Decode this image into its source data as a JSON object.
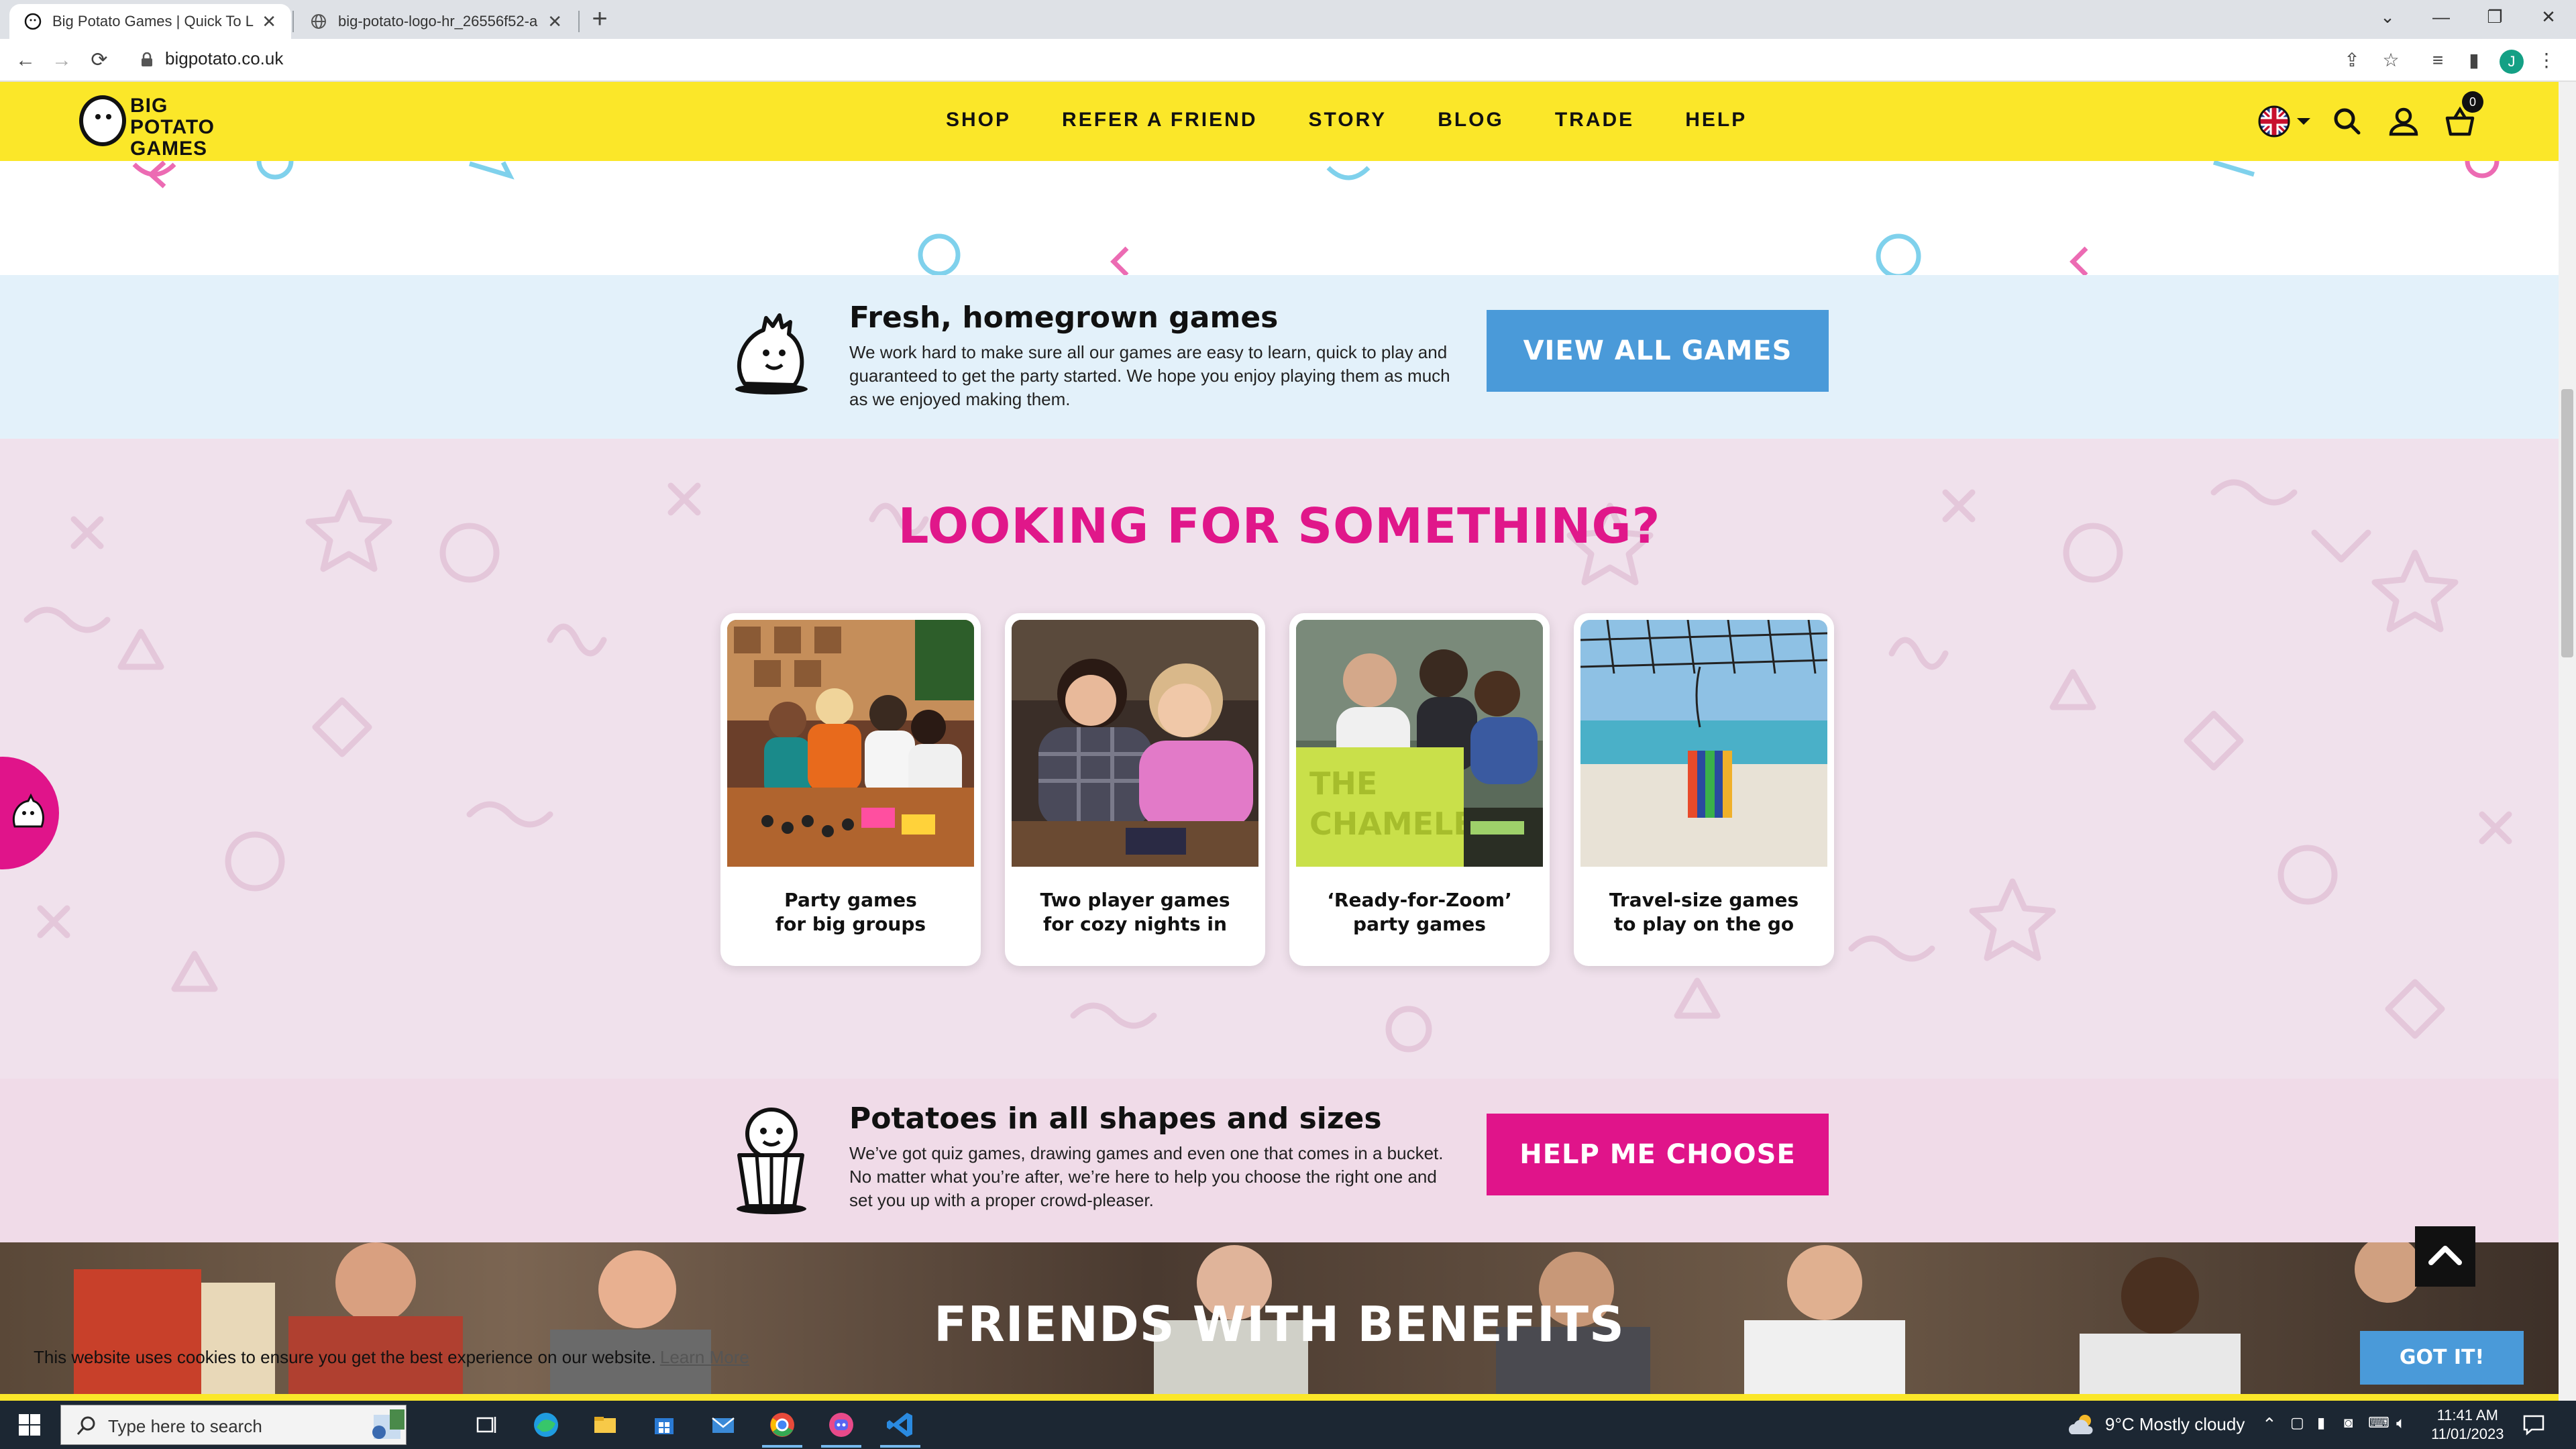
{
  "browser": {
    "tabs": [
      {
        "title": "Big Potato Games | Quick To Lea",
        "active": true
      },
      {
        "title": "big-potato-logo-hr_26556f52-a",
        "active": false
      }
    ],
    "url": "bigpotato.co.uk",
    "profile_initial": "J"
  },
  "header": {
    "logo_line1": "BIG POTATO",
    "logo_line2": "GAMES",
    "menu": [
      "SHOP",
      "REFER A FRIEND",
      "STORY",
      "BLOG",
      "TRADE",
      "HELP"
    ],
    "cart_count": "0"
  },
  "fresh": {
    "title": "Fresh, homegrown games",
    "body": "We work hard to make sure all our games are easy to learn, quick to play and guaranteed to get the party started. We hope you enjoy playing them as much as we enjoyed making them.",
    "button": "VIEW ALL GAMES"
  },
  "looking": {
    "title": "LOOKING FOR SOMETHING?",
    "cards": [
      {
        "line1": "Party games",
        "line2": "for big groups"
      },
      {
        "line1": "Two player games",
        "line2": "for cozy nights in"
      },
      {
        "line1": "‘Ready-for-Zoom’",
        "line2": "party games"
      },
      {
        "line1": "Travel-size games",
        "line2": "to play on the go"
      }
    ]
  },
  "potatoes": {
    "title": "Potatoes in all shapes and sizes",
    "body": "We’ve got quiz games, drawing games and even one that comes in a bucket. No matter what you’re after, we’re here to help you choose the right one and set you up with a proper crowd-pleaser.",
    "button": "HELP ME CHOOSE"
  },
  "friends": {
    "title": "FRIENDS WITH BENEFITS"
  },
  "cookie": {
    "text": "This website uses cookies to ensure you get the best experience on our website.",
    "link": "Learn More",
    "button": "GOT IT!"
  },
  "taskbar": {
    "search_placeholder": "Type here to search",
    "weather": "9°C  Mostly cloudy",
    "time": "11:41 AM",
    "date": "11/01/2023"
  },
  "colors": {
    "brand_yellow": "#fbe729",
    "brand_pink": "#e0148a",
    "brand_blue": "#4a9ad9"
  }
}
